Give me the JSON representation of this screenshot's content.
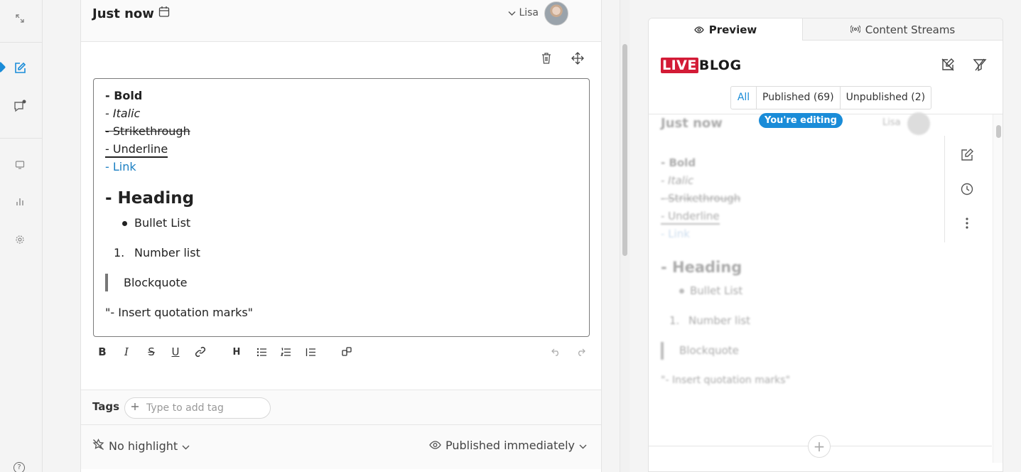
{
  "post": {
    "timestamp": "Just now",
    "author": "Lisa"
  },
  "editor": {
    "lines": {
      "bold": "- Bold",
      "italic": "- Italic",
      "strike": "- Strikethrough",
      "underline": "- Underline",
      "link": "- Link",
      "heading": "- Heading",
      "bullet": "Bullet List",
      "number_marker": "1.",
      "number": "Number list",
      "blockquote": "Blockquote",
      "quote": "\"- Insert quotation marks\""
    }
  },
  "tags": {
    "label": "Tags",
    "placeholder": "Type to add tag"
  },
  "footer": {
    "highlight": "No highlight",
    "publish": "Published immediately"
  },
  "preview": {
    "tabs": {
      "preview": "Preview",
      "streams": "Content Streams"
    },
    "logo": {
      "live": "LIVE",
      "blog": "BLOG"
    },
    "filters": {
      "all": "All",
      "published": "Published (69)",
      "unpublished": "Unpublished (2)"
    },
    "post": {
      "timestamp": "Just now",
      "editing_badge": "You're editing",
      "author": "Lisa"
    }
  },
  "colors": {
    "accent": "#1a8cd8",
    "brand_red": "#d31b36",
    "link": "#1b7fc3"
  }
}
